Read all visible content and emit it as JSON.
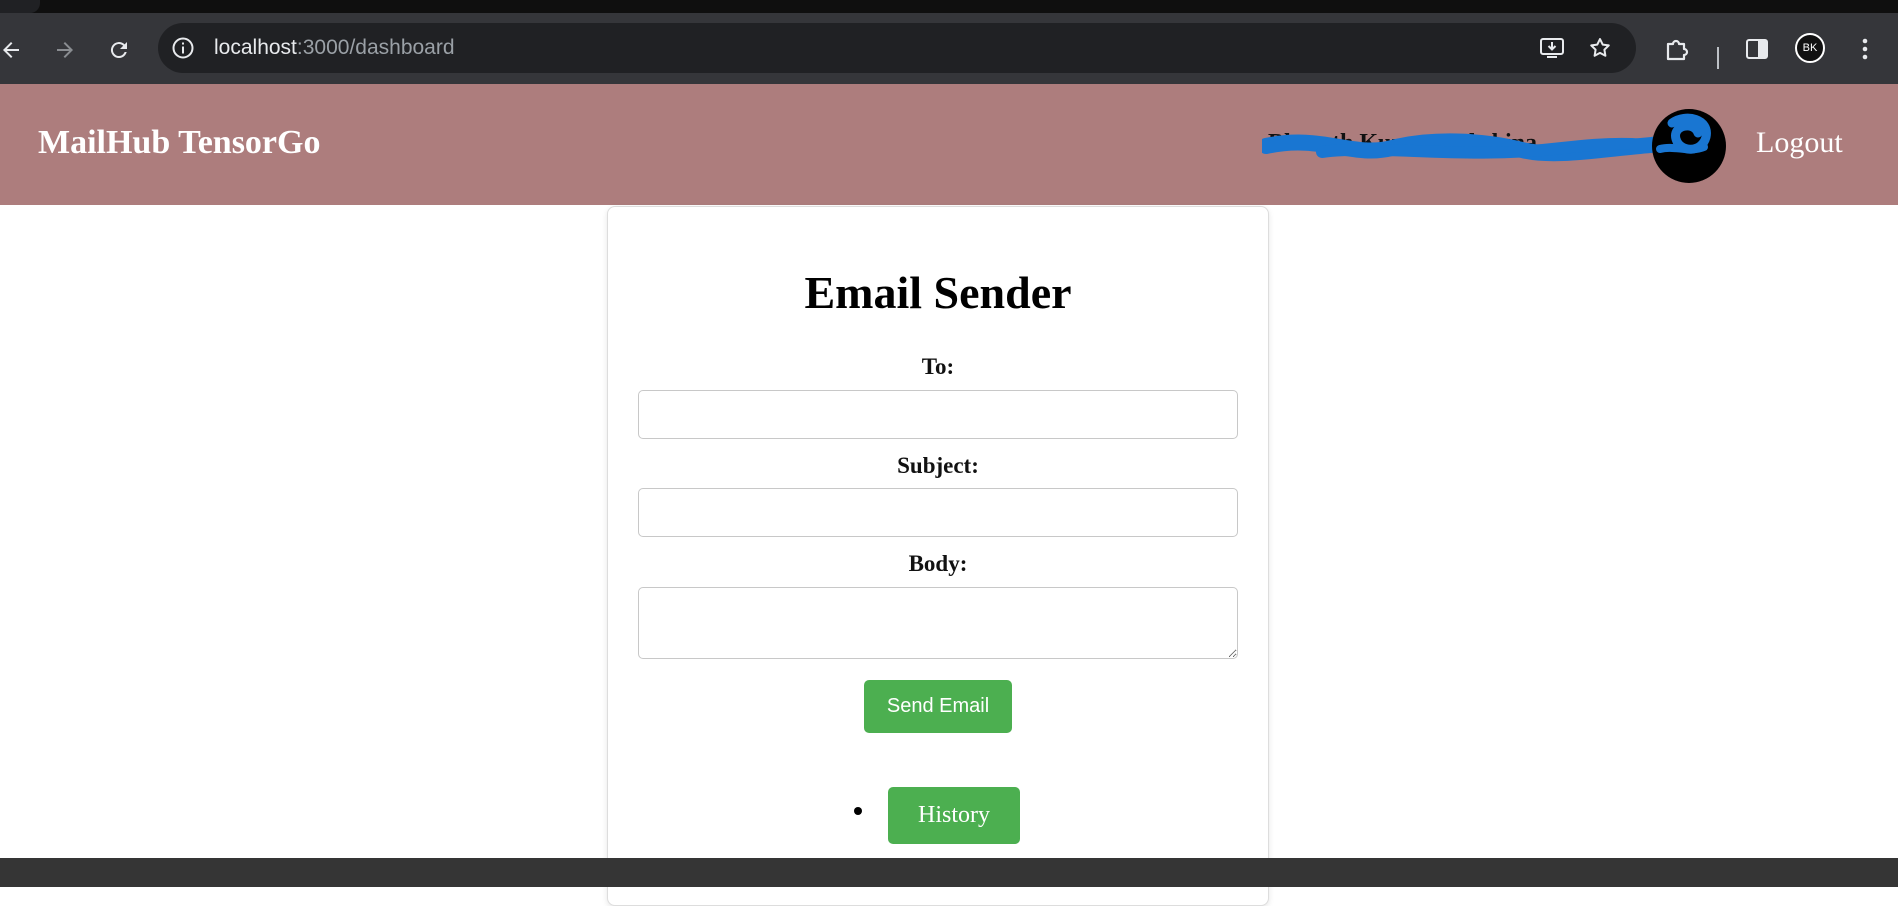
{
  "browser": {
    "url_host": "localhost",
    "url_rest": ":3000/dashboard",
    "profile_initials": "BK"
  },
  "header": {
    "brand": "MailHub TensorGo",
    "user_name": "Bharath Kumar Dakshina",
    "logout_label": "Logout"
  },
  "form": {
    "title": "Email Sender",
    "to_label": "To:",
    "to_value": "",
    "subject_label": "Subject:",
    "subject_value": "",
    "body_label": "Body:",
    "body_value": "",
    "send_label": "Send Email"
  },
  "nav": {
    "history_label": "History"
  },
  "colors": {
    "header_bg": "#ad7d7d",
    "button_green": "#4caf50",
    "redaction_blue": "#1976d2"
  }
}
